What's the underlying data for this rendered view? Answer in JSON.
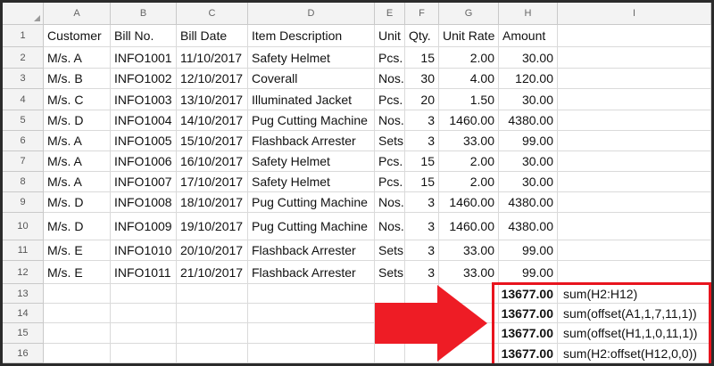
{
  "columns": [
    "A",
    "B",
    "C",
    "D",
    "E",
    "F",
    "G",
    "H",
    "I"
  ],
  "rows": [
    [
      "Customer",
      "Bill No.",
      "Bill Date",
      "Item Description",
      "Unit",
      "Qty.",
      "Unit Rate",
      "Amount",
      ""
    ],
    [
      "M/s. A",
      "INFO1001",
      "11/10/2017",
      "Safety Helmet",
      "Pcs.",
      "15",
      "2.00",
      "30.00",
      ""
    ],
    [
      "M/s. B",
      "INFO1002",
      "12/10/2017",
      "Coverall",
      "Nos.",
      "30",
      "4.00",
      "120.00",
      ""
    ],
    [
      "M/s. C",
      "INFO1003",
      "13/10/2017",
      "Illuminated Jacket",
      "Pcs.",
      "20",
      "1.50",
      "30.00",
      ""
    ],
    [
      "M/s. D",
      "INFO1004",
      "14/10/2017",
      "Pug Cutting Machine",
      "Nos.",
      "3",
      "1460.00",
      "4380.00",
      ""
    ],
    [
      "M/s. A",
      "INFO1005",
      "15/10/2017",
      "Flashback Arrester",
      "Sets",
      "3",
      "33.00",
      "99.00",
      ""
    ],
    [
      "M/s. A",
      "INFO1006",
      "16/10/2017",
      "Safety Helmet",
      "Pcs.",
      "15",
      "2.00",
      "30.00",
      ""
    ],
    [
      "M/s. A",
      "INFO1007",
      "17/10/2017",
      "Safety Helmet",
      "Pcs.",
      "15",
      "2.00",
      "30.00",
      ""
    ],
    [
      "M/s. D",
      "INFO1008",
      "18/10/2017",
      "Pug Cutting Machine",
      "Nos.",
      "3",
      "1460.00",
      "4380.00",
      ""
    ],
    [
      "M/s. D",
      "INFO1009",
      "19/10/2017",
      "Pug Cutting Machine",
      "Nos.",
      "3",
      "1460.00",
      "4380.00",
      ""
    ],
    [
      "M/s. E",
      "INFO1010",
      "20/10/2017",
      "Flashback Arrester",
      "Sets",
      "3",
      "33.00",
      "99.00",
      ""
    ],
    [
      "M/s. E",
      "INFO1011",
      "21/10/2017",
      "Flashback Arrester",
      "Sets",
      "3",
      "33.00",
      "99.00",
      ""
    ],
    [
      "",
      "",
      "",
      "",
      "",
      "",
      "",
      "13677.00",
      "sum(H2:H12)"
    ],
    [
      "",
      "",
      "",
      "",
      "",
      "",
      "",
      "13677.00",
      "sum(offset(A1,1,7,11,1))"
    ],
    [
      "",
      "",
      "",
      "",
      "",
      "",
      "",
      "13677.00",
      "sum(offset(H1,1,0,11,1))"
    ],
    [
      "",
      "",
      "",
      "",
      "",
      "",
      "",
      "13677.00",
      "sum(H2:offset(H12,0,0))"
    ]
  ],
  "colors": {
    "highlight": "#e8141e",
    "arrow": "#ee1c25"
  }
}
